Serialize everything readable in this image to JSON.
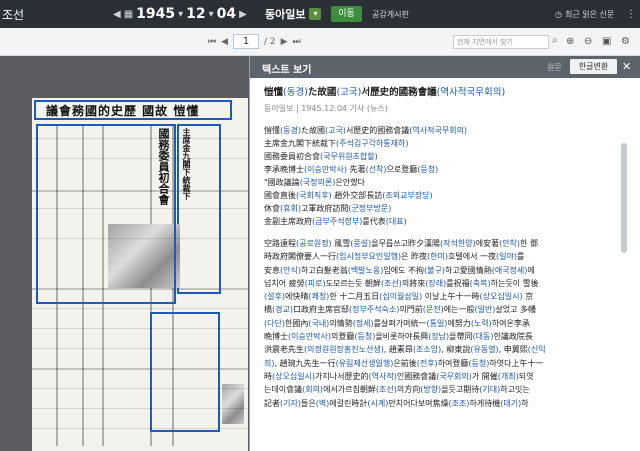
{
  "topbar": {
    "title": "조선",
    "year": "1945",
    "month": "12",
    "day": "04",
    "prev": "◀",
    "next": "▶",
    "paper": "동아일보",
    "go": "이동",
    "board": "공감게시판",
    "recent": "최근 읽은 신문",
    "dots": "⋮"
  },
  "toolbar": {
    "page_current": "1",
    "page_total": "/ 2",
    "search_placeholder": "현재 지면에서 찾기"
  },
  "newspaper": {
    "masthead": "議會務國的史歷 國故 愷懂",
    "headline1": "國務委員初合會",
    "headline2": "主席金九閣下統裁下"
  },
  "panel": {
    "title": "텍스트 보기",
    "original": "원문",
    "convert": "한글변환",
    "close": "✕"
  },
  "article": {
    "title_parts": [
      {
        "t": "愷懂",
        "c": "n"
      },
      {
        "t": "(동경)",
        "c": "b"
      },
      {
        "t": "た故國",
        "c": "n"
      },
      {
        "t": "(고국)",
        "c": "b"
      },
      {
        "t": "서歷史的國務會議",
        "c": "n"
      },
      {
        "t": "(역사적국무회의)",
        "c": "b"
      }
    ],
    "meta": "동아일보 | 1945.12.04 기사 (뉴스)",
    "sub_lines": [
      [
        {
          "t": "愷懂",
          "c": "n"
        },
        {
          "t": "(동경)",
          "c": "b"
        },
        {
          "t": "た故國",
          "c": "n"
        },
        {
          "t": "(고국)",
          "c": "b"
        },
        {
          "t": "서歷史的國務會議",
          "c": "n"
        },
        {
          "t": "(역사적국무회의)",
          "c": "b"
        }
      ],
      [
        {
          "t": "主席金九閣下統裁下",
          "c": "n"
        },
        {
          "t": "(주석김구각하통재하)",
          "c": "b"
        }
      ],
      [
        {
          "t": "國務委員初合會",
          "c": "n"
        },
        {
          "t": "(국무위원초합할)",
          "c": "b"
        }
      ],
      [
        {
          "t": "李承晩博士",
          "c": "n"
        },
        {
          "t": "(이승만박사)",
          "c": "b"
        },
        {
          "t": " 先著",
          "c": "n"
        },
        {
          "t": "(선착)",
          "c": "b"
        },
        {
          "t": "으로登廳",
          "c": "n"
        },
        {
          "t": "(등청)",
          "c": "b"
        }
      ],
      [
        {
          "t": "\"國政議論",
          "c": "n"
        },
        {
          "t": "(국정의론)",
          "c": "b"
        },
        {
          "t": "은안했다",
          "c": "n"
        }
      ],
      [
        {
          "t": "國會直後",
          "c": "n"
        },
        {
          "t": "(국회직후)",
          "c": "b"
        },
        {
          "t": " 趙外交部長訪",
          "c": "n"
        },
        {
          "t": "(조외교부장당)",
          "c": "b"
        }
      ],
      [
        {
          "t": "休會",
          "c": "n"
        },
        {
          "t": "(휴회)",
          "c": "b"
        },
        {
          "t": "고軍政府訪問",
          "c": "n"
        },
        {
          "t": "(군정부방문)",
          "c": "b"
        }
      ],
      [
        {
          "t": "金副主席政府",
          "c": "n"
        },
        {
          "t": "(금부주석정부)",
          "c": "b"
        },
        {
          "t": "를代表",
          "c": "n"
        },
        {
          "t": "(대표)",
          "c": "b"
        }
      ]
    ],
    "body_lines": [
      [
        {
          "t": "  空路遠程",
          "c": "n"
        },
        {
          "t": "(공로원정)",
          "c": "b"
        },
        {
          "t": " 風雪",
          "c": "n"
        },
        {
          "t": "(풍설)",
          "c": "b"
        },
        {
          "t": "을무릅쓰고昨夕漢陽",
          "c": "n"
        },
        {
          "t": "(작석한양)",
          "c": "b"
        },
        {
          "t": "에安著",
          "c": "n"
        },
        {
          "t": "(안착)",
          "c": "b"
        },
        {
          "t": "한 鄧",
          "c": "n"
        }
      ],
      [
        {
          "t": "時政府閣僚要人一行",
          "c": "n"
        },
        {
          "t": "(임시정부요인일행)",
          "c": "b"
        },
        {
          "t": "은 昨夜",
          "c": "n"
        },
        {
          "t": "(한미)",
          "c": "b"
        },
        {
          "t": "호텔에서 一夜",
          "c": "n"
        },
        {
          "t": "(일야)",
          "c": "b"
        },
        {
          "t": "를",
          "c": "n"
        }
      ],
      [
        {
          "t": "安息",
          "c": "n"
        },
        {
          "t": "(안식)",
          "c": "b"
        },
        {
          "t": "하고白髮老翁",
          "c": "n"
        },
        {
          "t": "(백발노옹)",
          "c": "b"
        },
        {
          "t": "임에도 不拘",
          "c": "n"
        },
        {
          "t": "(불구)",
          "c": "b"
        },
        {
          "t": "하고愛國情熱",
          "c": "n"
        },
        {
          "t": "(애국정세)",
          "c": "b"
        },
        {
          "t": "에",
          "c": "n"
        }
      ],
      [
        {
          "t": "넘치어 疲勞",
          "c": "n"
        },
        {
          "t": "(피로)",
          "c": "b"
        },
        {
          "t": "도모르는듯 朝鮮",
          "c": "n"
        },
        {
          "t": "(조선)",
          "c": "b"
        },
        {
          "t": "의將來",
          "c": "n"
        },
        {
          "t": "(장래)",
          "c": "b"
        },
        {
          "t": "를祝福",
          "c": "n"
        },
        {
          "t": "(축복)",
          "c": "b"
        },
        {
          "t": "하는듯이 雪後",
          "c": "n"
        }
      ],
      [
        {
          "t": "(설후)",
          "c": "b"
        },
        {
          "t": "에快晴",
          "c": "n"
        },
        {
          "t": "(쾌청)",
          "c": "b"
        },
        {
          "t": "한 十二月五日",
          "c": "n"
        },
        {
          "t": "(십이월삼일)",
          "c": "b"
        },
        {
          "t": " 이날上午十一時",
          "c": "n"
        },
        {
          "t": "(상오십일시)",
          "c": "b"
        },
        {
          "t": " 京",
          "c": "n"
        }
      ],
      [
        {
          "t": "橋",
          "c": "n"
        },
        {
          "t": "(경교)",
          "c": "b"
        },
        {
          "t": "口政府主席官邸",
          "c": "n"
        },
        {
          "t": "(정부주석숙소)",
          "c": "b"
        },
        {
          "t": "의門前",
          "c": "n"
        },
        {
          "t": "(문전)",
          "c": "b"
        },
        {
          "t": "에는一般",
          "c": "n"
        },
        {
          "t": "(일반)",
          "c": "b"
        },
        {
          "t": "살었고 多幡",
          "c": "n"
        }
      ],
      [
        {
          "t": "(다단)",
          "c": "b"
        },
        {
          "t": "한國內",
          "c": "n"
        },
        {
          "t": "(국내)",
          "c": "b"
        },
        {
          "t": "의情勢",
          "c": "n"
        },
        {
          "t": "(정세)",
          "c": "b"
        },
        {
          "t": "를살펴가며統一",
          "c": "n"
        },
        {
          "t": "(통일)",
          "c": "b"
        },
        {
          "t": "에努力",
          "c": "n"
        },
        {
          "t": "(노력)",
          "c": "b"
        },
        {
          "t": "하여온李承",
          "c": "n"
        }
      ],
      [
        {
          "t": "晩博士",
          "c": "n"
        },
        {
          "t": "(이승만박사)",
          "c": "b"
        },
        {
          "t": "의登廳",
          "c": "n"
        },
        {
          "t": "(등청)",
          "c": "b"
        },
        {
          "t": "을비롯하야長興",
          "c": "n"
        },
        {
          "t": "(장남)",
          "c": "b"
        },
        {
          "t": "을帶同",
          "c": "n"
        },
        {
          "t": "(대동)",
          "c": "b"
        },
        {
          "t": "한議政院長",
          "c": "n"
        }
      ],
      [
        {
          "t": "洪震老先生",
          "c": "n"
        },
        {
          "t": "(의정원원장홍진노선생)",
          "c": "b"
        },
        {
          "t": ", 趙素昂",
          "c": "n"
        },
        {
          "t": "(조소앙)",
          "c": "b"
        },
        {
          "t": ", 柳東說",
          "c": "n"
        },
        {
          "t": "(유동열)",
          "c": "b"
        },
        {
          "t": ", 申翼熙",
          "c": "n"
        },
        {
          "t": "(신익",
          "c": "b"
        }
      ],
      [
        {
          "t": "희)",
          "c": "b"
        },
        {
          "t": ", 趙琬九先生一行",
          "c": "n"
        },
        {
          "t": "(유림제선생일행)",
          "c": "b"
        },
        {
          "t": "은前後",
          "c": "n"
        },
        {
          "t": "(전후)",
          "c": "b"
        },
        {
          "t": "하여登廳",
          "c": "n"
        },
        {
          "t": "(등청)",
          "c": "b"
        },
        {
          "t": "하엿다上午十一",
          "c": "n"
        }
      ],
      [
        {
          "t": "時",
          "c": "n"
        },
        {
          "t": "(상오십일시)",
          "c": "b"
        },
        {
          "t": "가지나서歷史的",
          "c": "n"
        },
        {
          "t": "(역사적)",
          "c": "b"
        },
        {
          "t": "인國務會議",
          "c": "n"
        },
        {
          "t": "(국무회의)",
          "c": "b"
        },
        {
          "t": "가 開催",
          "c": "n"
        },
        {
          "t": "(개최)",
          "c": "b"
        },
        {
          "t": "되엿",
          "c": "n"
        }
      ],
      [
        {
          "t": "는데이會議",
          "c": "n"
        },
        {
          "t": "(회의)",
          "c": "b"
        },
        {
          "t": "에서가르침朝鮮",
          "c": "n"
        },
        {
          "t": "(조선)",
          "c": "b"
        },
        {
          "t": "의方向",
          "c": "n"
        },
        {
          "t": "(방향)",
          "c": "b"
        },
        {
          "t": "을듯고期待",
          "c": "n"
        },
        {
          "t": "(기대)",
          "c": "b"
        },
        {
          "t": "하고잇는",
          "c": "n"
        }
      ],
      [
        {
          "t": "記者",
          "c": "n"
        },
        {
          "t": "(기자)",
          "c": "b"
        },
        {
          "t": "들은",
          "c": "n"
        },
        {
          "t": "",
          "c": "n"
        },
        {
          "t": "(벽)",
          "c": "b"
        },
        {
          "t": "에걸린時計",
          "c": "n"
        },
        {
          "t": "(시계)",
          "c": "b"
        },
        {
          "t": "만치어다보며焦燥",
          "c": "n"
        },
        {
          "t": "(조조)",
          "c": "b"
        },
        {
          "t": "하게待機",
          "c": "n"
        },
        {
          "t": "(대기)",
          "c": "b"
        },
        {
          "t": "하",
          "c": "n"
        }
      ]
    ]
  }
}
